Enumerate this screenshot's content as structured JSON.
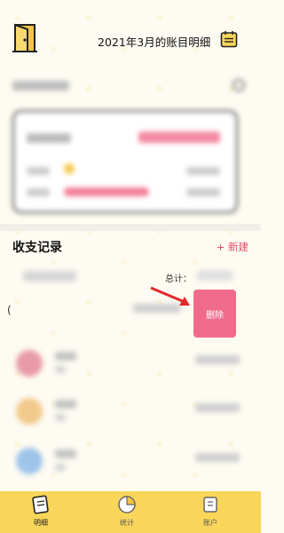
{
  "header": {
    "title": "2021年3月的账目明细",
    "left_icon": "door-icon",
    "right_icon": "calendar-icon"
  },
  "records": {
    "title": "收支记录",
    "new_label": "+ 新建",
    "total_label": "总计：",
    "delete_label": "删除"
  },
  "tabbar": {
    "tabs": [
      {
        "label": "明细",
        "icon": "ledger-icon",
        "active": true
      },
      {
        "label": "统计",
        "icon": "pie-chart-icon",
        "active": false
      },
      {
        "label": "账户",
        "icon": "wallet-icon",
        "active": false
      }
    ]
  },
  "colors": {
    "accent": "#f9d65a",
    "danger": "#f06b8b",
    "new_text": "#e94b6a",
    "background": "#fdfbf2"
  }
}
